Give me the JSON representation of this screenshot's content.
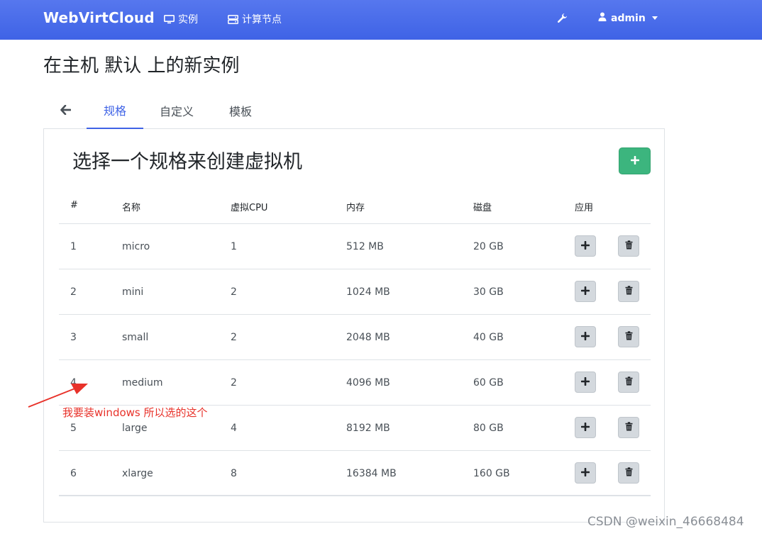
{
  "navbar": {
    "brand": "WebVirtCloud",
    "instances_label": "实例",
    "nodes_label": "计算节点",
    "user_label": "admin",
    "icons": [
      "monitor-icon",
      "server-icon",
      "wrench-icon",
      "user-icon",
      "caret-down-icon"
    ]
  },
  "page": {
    "title": "在主机 默认 上的新实例"
  },
  "tabs": {
    "flavors": "规格",
    "custom": "自定义",
    "template": "模板"
  },
  "card": {
    "title": "选择一个规格来创建虚拟机"
  },
  "table": {
    "headers": {
      "num": "#",
      "name": "名称",
      "vcpu": "虚拟CPU",
      "memory": "内存",
      "disk": "磁盘",
      "apply": "应用"
    },
    "rows": [
      {
        "num": "1",
        "name": "micro",
        "vcpu": "1",
        "memory": "512 MB",
        "disk": "20 GB"
      },
      {
        "num": "2",
        "name": "mini",
        "vcpu": "2",
        "memory": "1024 MB",
        "disk": "30 GB"
      },
      {
        "num": "3",
        "name": "small",
        "vcpu": "2",
        "memory": "2048 MB",
        "disk": "40 GB"
      },
      {
        "num": "4",
        "name": "medium",
        "vcpu": "2",
        "memory": "4096 MB",
        "disk": "60 GB"
      },
      {
        "num": "5",
        "name": "large",
        "vcpu": "4",
        "memory": "8192 MB",
        "disk": "80 GB"
      },
      {
        "num": "6",
        "name": "xlarge",
        "vcpu": "8",
        "memory": "16384 MB",
        "disk": "160 GB"
      }
    ]
  },
  "annotation": {
    "text": "我要装windows 所以选的这个",
    "color": "#e8322a"
  },
  "watermark": "CSDN @weixin_46668484",
  "colors": {
    "navbar": "#3f63e6",
    "accent": "#3f63e6",
    "success": "#3cb57e"
  }
}
